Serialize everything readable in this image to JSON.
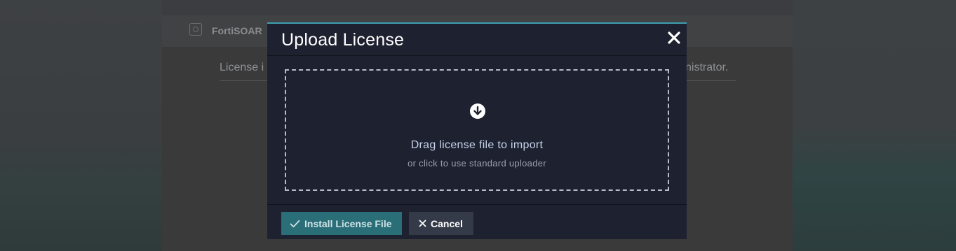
{
  "background": {
    "brand": "FortiSOAR",
    "message_left": "License i",
    "message_right": "nistrator."
  },
  "modal": {
    "title": "Upload License",
    "close_icon": "close-icon",
    "dropzone": {
      "icon": "arrow-down-circle-icon",
      "title": "Drag license file to import",
      "subtitle": "or click to use standard uploader"
    },
    "footer": {
      "install_label": "Install License File",
      "install_icon": "check-icon",
      "cancel_label": "Cancel",
      "cancel_icon": "close-icon"
    },
    "accent_color": "#3f9fb3",
    "primary_button_color": "#2a6e78"
  }
}
